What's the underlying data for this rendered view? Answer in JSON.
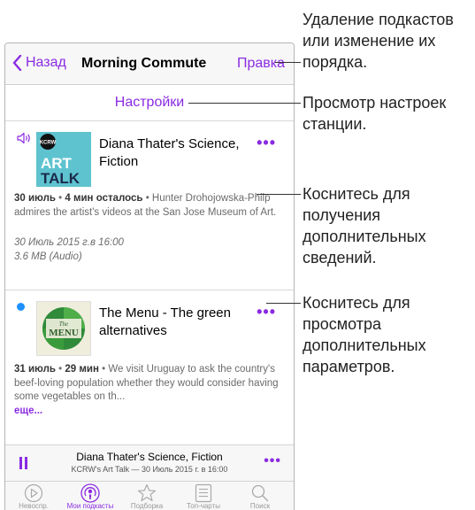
{
  "navbar": {
    "back_label": "Назад",
    "title": "Morning Commute",
    "edit_label": "Правка"
  },
  "settings": {
    "label": "Настройки"
  },
  "episodes": [
    {
      "title": "Diana Thater's Science, Fiction",
      "art_lines": [
        "KCRW",
        "ART",
        "TALK"
      ],
      "date": "30 июль",
      "duration": "4 мин осталось",
      "description": "Hunter Drohojowska-Philp admires the artist's videos at the San Jose Museum of Art.",
      "pub_date": "30 Июль 2015 г.в 16:00",
      "size": "3.6 MB (Audio)"
    },
    {
      "title": "The Menu - The green alternatives",
      "art_lines": [
        "The",
        "MENU"
      ],
      "date": "31 июль",
      "duration": "29 мин",
      "description": "We visit Uruguay to ask the country's beef-loving population whether they would consider having some vegetables on th...",
      "more_link": "еще..."
    }
  ],
  "now_playing": {
    "title": "Diana Thater's Science, Fiction",
    "subtitle": "KCRW's Art Talk — 30 Июль 2015 г. в 16:00"
  },
  "tabs": [
    {
      "label": "Невоспр."
    },
    {
      "label": "Мои подкасты"
    },
    {
      "label": "Подборка"
    },
    {
      "label": "Топ-чарты"
    },
    {
      "label": "Поиск"
    }
  ],
  "callouts": {
    "edit": "Удаление подкастов или изменение их порядка.",
    "settings": "Просмотр настроек станции.",
    "details": "Коснитесь для получения дополнительных сведений.",
    "options": "Коснитесь для просмотра дополнительных параметров."
  },
  "colors": {
    "accent": "#8a2be2",
    "unplayed_dot": "#1e90ff",
    "art_talk_bg": "#5ec3cf"
  }
}
